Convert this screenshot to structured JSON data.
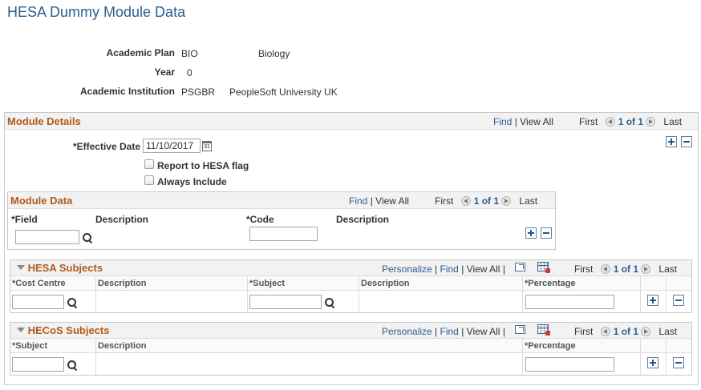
{
  "page": {
    "title": "HESA Dummy Module Data"
  },
  "header": {
    "academic_plan_label": "Academic Plan",
    "academic_plan_code": "BIO",
    "academic_plan_desc": "Biology",
    "year_label": "Year",
    "year_value": "0",
    "institution_label": "Academic Institution",
    "institution_code": "PSGBR",
    "institution_desc": "PeopleSoft University UK"
  },
  "nav": {
    "find": "Find",
    "sep": "|",
    "view_all": "View All",
    "first": "First",
    "count": "1 of 1",
    "last": "Last",
    "personalize": "Personalize"
  },
  "module_details": {
    "title": "Module Details",
    "effective_date_label": "*Effective Date",
    "effective_date_value": "11/10/2017",
    "calendar_glyph": "31",
    "report_flag_label": "Report to HESA flag",
    "always_include_label": "Always Include"
  },
  "module_data": {
    "title": "Module Data",
    "field_label": "*Field",
    "description_label": "Description",
    "code_label": "*Code",
    "description2_label": "Description"
  },
  "hesa_subjects": {
    "title": "HESA Subjects",
    "columns": [
      "*Cost Centre",
      "Description",
      "*Subject",
      "Description",
      "*Percentage"
    ]
  },
  "hecos_subjects": {
    "title": "HECoS Subjects",
    "columns": [
      "*Subject",
      "Description",
      "*Percentage"
    ]
  },
  "colors": {
    "title": "#2b5f8f",
    "section_title": "#b05a1a",
    "link": "#2b5f8f"
  }
}
